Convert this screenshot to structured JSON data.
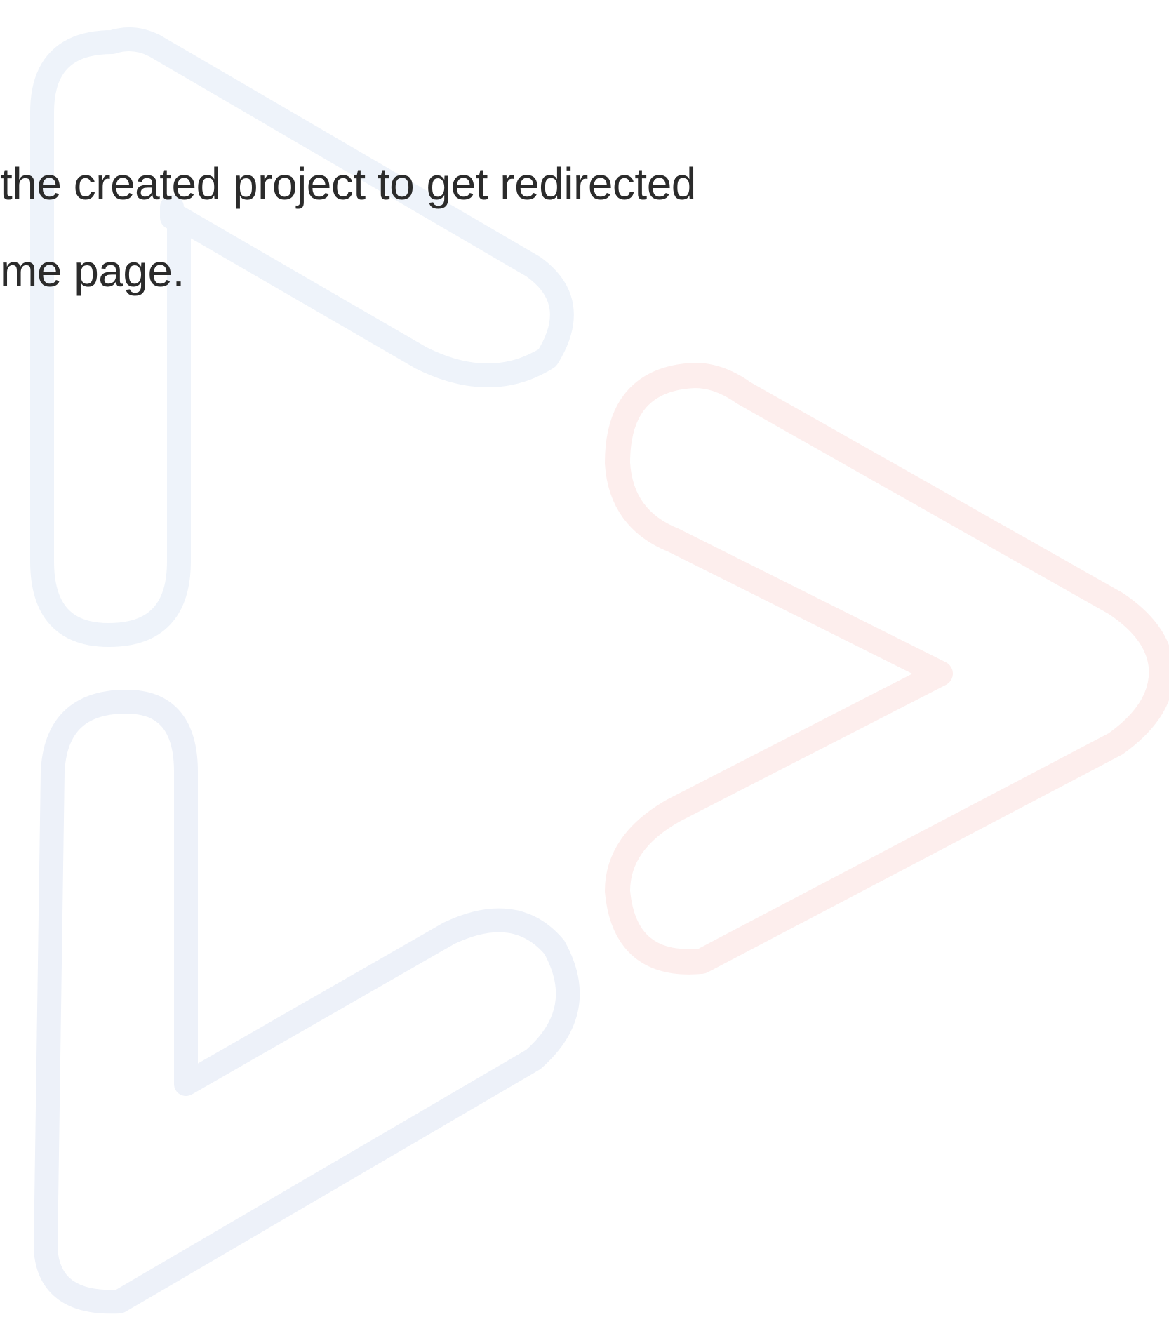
{
  "body_text": {
    "line1": "the created project to get redirected",
    "line2": "me page."
  },
  "watermark": {
    "icon": "play-logo-watermark",
    "color_blue": "#eef3fa",
    "color_red": "#fdeeed"
  }
}
